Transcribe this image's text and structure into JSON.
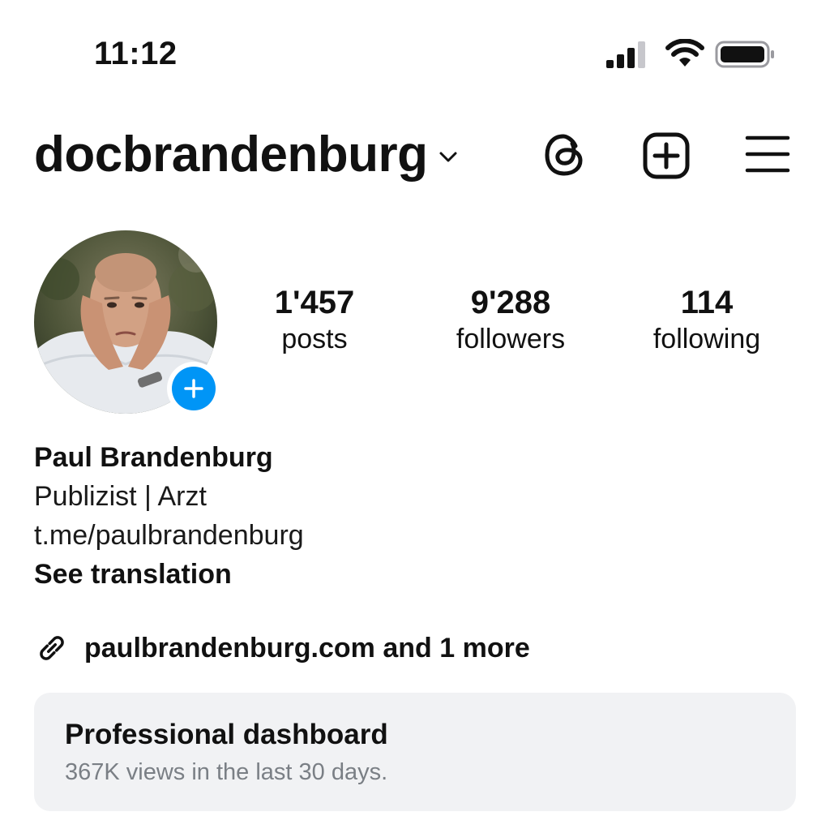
{
  "status_bar": {
    "time": "11:12",
    "icons": [
      "signal-icon",
      "wifi-icon",
      "battery-icon"
    ]
  },
  "header": {
    "username": "docbrandenburg",
    "actions": [
      "threads-icon",
      "new-post-icon",
      "menu-icon"
    ]
  },
  "profile": {
    "avatar": "avatar",
    "add_story_icon": "plus-icon",
    "stats": [
      {
        "value": "1'457",
        "label": "posts"
      },
      {
        "value": "9'288",
        "label": "followers"
      },
      {
        "value": "114",
        "label": "following"
      }
    ]
  },
  "bio": {
    "name": "Paul Brandenburg",
    "line1": "Publizist | Arzt",
    "line2": "t.me/paulbrandenburg",
    "translate": "See translation"
  },
  "links": {
    "icon": "link-icon",
    "text": "paulbrandenburg.com and 1 more"
  },
  "dashboard": {
    "title": "Professional dashboard",
    "subtitle": "367K views in the last 30 days."
  },
  "colors": {
    "accent_blue": "#0095f6",
    "dashboard_bg": "#f1f2f4",
    "muted_text": "#7a7f85"
  }
}
